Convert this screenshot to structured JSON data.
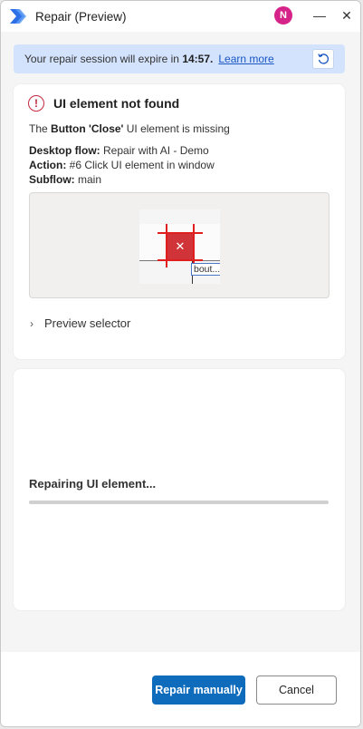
{
  "window": {
    "title": "Repair (Preview)",
    "avatar_initial": "N",
    "minimize_glyph": "—",
    "close_glyph": "✕"
  },
  "banner": {
    "prefix": "Your repair session will expire in",
    "time": "14:57.",
    "link": "Learn more"
  },
  "error": {
    "title": "UI element not found",
    "icon_glyph": "!",
    "desc_prefix": "The",
    "desc_element": "Button 'Close'",
    "desc_suffix": "UI element is missing",
    "flow_label": "Desktop flow:",
    "flow_value": "Repair with AI - Demo",
    "action_label": "Action:",
    "action_value": "#6 Click UI element in window",
    "subflow_label": "Subflow:",
    "subflow_value": "main",
    "preview_close_glyph": "✕",
    "preview_about_text": "bout...",
    "selector_label": "Preview selector",
    "selector_chevron": "›"
  },
  "progress": {
    "label": "Repairing UI element...",
    "fraction": 1.0
  },
  "footer": {
    "primary_label": "Repair manually",
    "secondary_label": "Cancel"
  },
  "colors": {
    "accent": "#0f6cbd",
    "error": "#c4283c",
    "banner_bg": "#d3e3fd",
    "avatar": "#d6238a"
  }
}
